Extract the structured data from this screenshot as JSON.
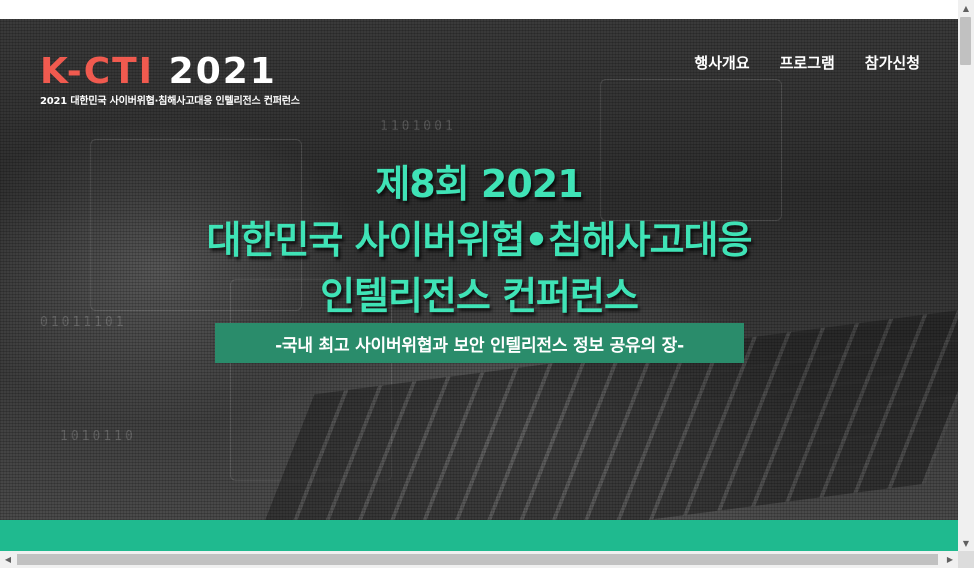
{
  "header": {
    "logo": {
      "brand": "K-CTI",
      "year": "2021",
      "tagline": "2021 대한민국 사이버위협·침해사고대응 인텔리전스 컨퍼런스"
    },
    "nav": [
      "행사개요",
      "프로그램",
      "참가신청"
    ]
  },
  "hero": {
    "title_lines": [
      "제8회 2021",
      "대한민국 사이버위협•침해사고대응",
      "인텔리전스 컨퍼런스"
    ],
    "subtitle": "-국내 최고 사이버위협과 보안 인텔리전스 정보 공유의 장-"
  },
  "colors": {
    "accent_green": "#3fe3b6",
    "subtitle_bg": "#2a8c6b",
    "band_green": "#1fba8f",
    "logo_red": "#f05a4f"
  },
  "scrollbars": {
    "up_icon": "arrow-up-icon",
    "down_icon": "arrow-down-icon",
    "left_icon": "arrow-left-icon",
    "right_icon": "arrow-right-icon"
  }
}
